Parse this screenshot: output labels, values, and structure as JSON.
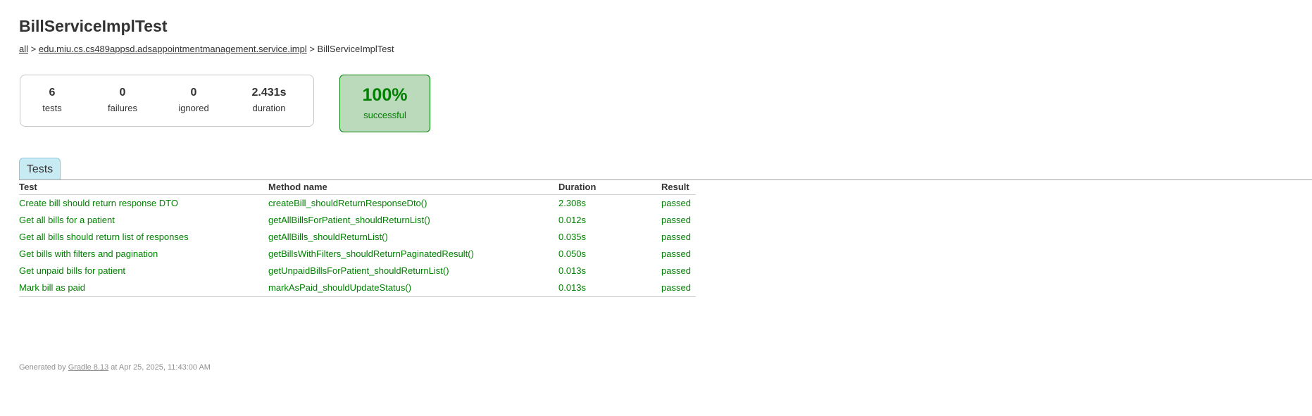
{
  "page": {
    "title": "BillServiceImplTest"
  },
  "breadcrumbs": {
    "all_label": "all",
    "sep1": ">",
    "package_label": "edu.miu.cs.cs489appsd.adsappointmentmanagement.service.impl",
    "sep2": ">",
    "current": "BillServiceImplTest"
  },
  "summary": {
    "tests": {
      "value": "6",
      "label": "tests"
    },
    "failures": {
      "value": "0",
      "label": "failures"
    },
    "ignored": {
      "value": "0",
      "label": "ignored"
    },
    "duration": {
      "value": "2.431s",
      "label": "duration"
    }
  },
  "success_rate": {
    "value": "100%",
    "label": "successful",
    "color": "#008000",
    "background": "#bbd9bb"
  },
  "tabs": [
    {
      "label": "Tests",
      "active": true
    }
  ],
  "table": {
    "headers": {
      "test": "Test",
      "method": "Method name",
      "duration": "Duration",
      "result": "Result"
    },
    "rows": [
      {
        "test": "Create bill should return response DTO",
        "method": "createBill_shouldReturnResponseDto()",
        "duration": "2.308s",
        "result": "passed"
      },
      {
        "test": "Get all bills for a patient",
        "method": "getAllBillsForPatient_shouldReturnList()",
        "duration": "0.012s",
        "result": "passed"
      },
      {
        "test": "Get all bills should return list of responses",
        "method": "getAllBills_shouldReturnList()",
        "duration": "0.035s",
        "result": "passed"
      },
      {
        "test": "Get bills with filters and pagination",
        "method": "getBillsWithFilters_shouldReturnPaginatedResult()",
        "duration": "0.050s",
        "result": "passed"
      },
      {
        "test": "Get unpaid bills for patient",
        "method": "getUnpaidBillsForPatient_shouldReturnList()",
        "duration": "0.013s",
        "result": "passed"
      },
      {
        "test": "Mark bill as paid",
        "method": "markAsPaid_shouldUpdateStatus()",
        "duration": "0.013s",
        "result": "passed"
      }
    ],
    "pass_color": "#008000"
  },
  "footer": {
    "prefix": "Generated by",
    "link_label": "Gradle 8.13",
    "suffix": "at Apr 25, 2025, 11:43:00 AM"
  }
}
